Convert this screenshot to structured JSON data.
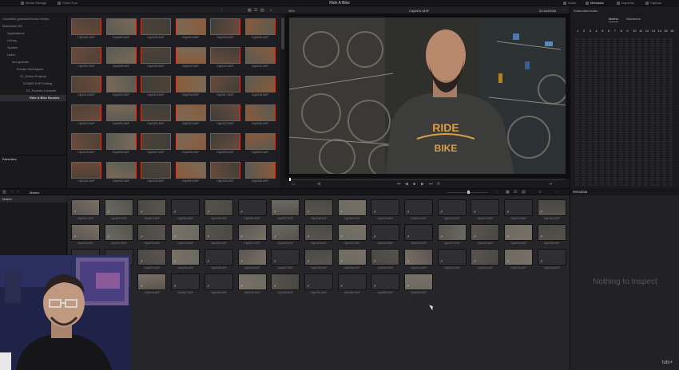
{
  "top_tabs": [
    {
      "label": "Media Storage"
    },
    {
      "label": "Clone Tool"
    },
    {
      "label": "Audio"
    },
    {
      "label": "Metadata"
    },
    {
      "label": "Inspector"
    },
    {
      "label": "Capture"
    }
  ],
  "app_title": "Ride A Bike",
  "viewer": {
    "zoom": "39%",
    "clip_name": "Clip0001.MXF",
    "timecode": "22:34:09:02",
    "shirt_text_1": "RIDE",
    "shirt_text_2": "BIKE"
  },
  "right_panel": {
    "header": "Embedded Audio",
    "tabs": [
      "Meters",
      "Waveform"
    ],
    "channels": [
      "1",
      "2",
      "3",
      "4",
      "5",
      "6",
      "7",
      "8",
      "9",
      "10",
      "11",
      "12",
      "13",
      "14",
      "15",
      "16"
    ]
  },
  "tree": {
    "items": [
      {
        "label": "Clownfish-graham/Envato Worke..."
      },
      {
        "label": "Macintosh HD"
      },
      {
        "label": "Applications"
      },
      {
        "label": "Library"
      },
      {
        "label": "System"
      },
      {
        "label": "Users"
      },
      {
        "label": "tom.graham"
      },
      {
        "label": "Envato Workspace"
      },
      {
        "label": "02_Active Projects"
      },
      {
        "label": "220805 DVR Editing"
      },
      {
        "label": "02_Rushes & Assets"
      },
      {
        "label": "Ride A Bike Rushes"
      }
    ],
    "favorites_label": "Favorites"
  },
  "storage_clips": [
    "Clip0001.MXF",
    "Clip0002.MXF",
    "Clip0003.MXF",
    "Clip0004.MXF",
    "Clip0005.MXF",
    "Clip0006.MXF",
    "Clip0007.MXF",
    "Clip0008.MXF",
    "Clip0009.MXF",
    "Clip0010.MXF",
    "Clip0011.MXF",
    "Clip0012.MXF",
    "Clip0013.MXF",
    "Clip0014.MXF",
    "Clip0015.MXF",
    "Clip0016.MXF",
    "Clip0017.MXF",
    "Clip0018.MXF",
    "Clip0019.MXF",
    "Clip0020.MXF",
    "Clip0021.MXF",
    "Clip0022.MXF",
    "Clip0023.MXF",
    "Clip0024.MXF",
    "Clip0025.MXF",
    "Clip0026.MXF",
    "Clip0027.MXF",
    "Clip0028.MXF",
    "Clip0029.MXF",
    "Clip0030.MXF",
    "Clip0031.MXF",
    "Clip0032.MXF",
    "Clip0033.MXF",
    "Clip0034.MXF",
    "Clip0035.MXF",
    "Clip0036.MXF"
  ],
  "media_pool": {
    "bin_title": "Master",
    "master_bin_label": "Master",
    "clips": [
      "Clip0001.MXF",
      "Clip0002.MXF",
      "Clip0003.MXF",
      "Clip0004.MXF",
      "Clip0005.MXF",
      "Clip0006.MXF",
      "Clip0007.MXF",
      "Clip0008.MXF",
      "Clip0009.MXF",
      "Clip0010.MXF",
      "Clip0011.MXF",
      "Clip0012.MXF",
      "Clip0013.MXF",
      "Clip0014.MXF",
      "Clip0015.MXF",
      "Clip0016.MXF",
      "Clip0017.MXF",
      "Clip0018.MXF",
      "Clip0019.MXF",
      "Clip0020.MXF",
      "Clip0021.MXF",
      "Clip0022.MXF",
      "Clip0023.MXF",
      "Clip0024.MXF",
      "Clip0025.MXF",
      "Clip0026.MXF",
      "Clip0027.MXF",
      "Clip0028.MXF",
      "Clip0029.MXF",
      "Clip0030.MXF",
      "Clip0031.MXF",
      "Clip0032.MXF",
      "Clip0033.MXF",
      "Clip0034.MXF",
      "Clip0035.MXF",
      "Clip0036.MXF",
      "Clip0037.MXF",
      "Clip0038.MXF",
      "Clip0039.MXF",
      "Clip0040.MXF",
      "Clip0041.MXF",
      "Clip0042.MXF",
      "Clip0043.MXF",
      "Clip0044.MXF",
      "Clip0045.MXF",
      "Clip0046.MXF",
      "Clip0047.MXF",
      "Clip0048.MXF",
      "Clip0049.MXF",
      "Clip0050.MXF",
      "Clip0051.MXF",
      "Clip0052.MXF",
      "Clip0053.MXF",
      "Clip0054.MXF"
    ],
    "thumb_clips": [
      1,
      2,
      3,
      5,
      7,
      8,
      9,
      15,
      16,
      17,
      18,
      19,
      20,
      21,
      22,
      23,
      24,
      27,
      28,
      29,
      30,
      33,
      34,
      36,
      38,
      39,
      40,
      41,
      43,
      44,
      46,
      49,
      50,
      54
    ]
  },
  "metadata": {
    "header": "Metadata",
    "empty_message": "Nothing to Inspect"
  },
  "watermark": "tuts+",
  "colors": {
    "selection_red": "#c83a2a",
    "accent_red": "#d04040",
    "panel_dark": "#1c1c20"
  }
}
